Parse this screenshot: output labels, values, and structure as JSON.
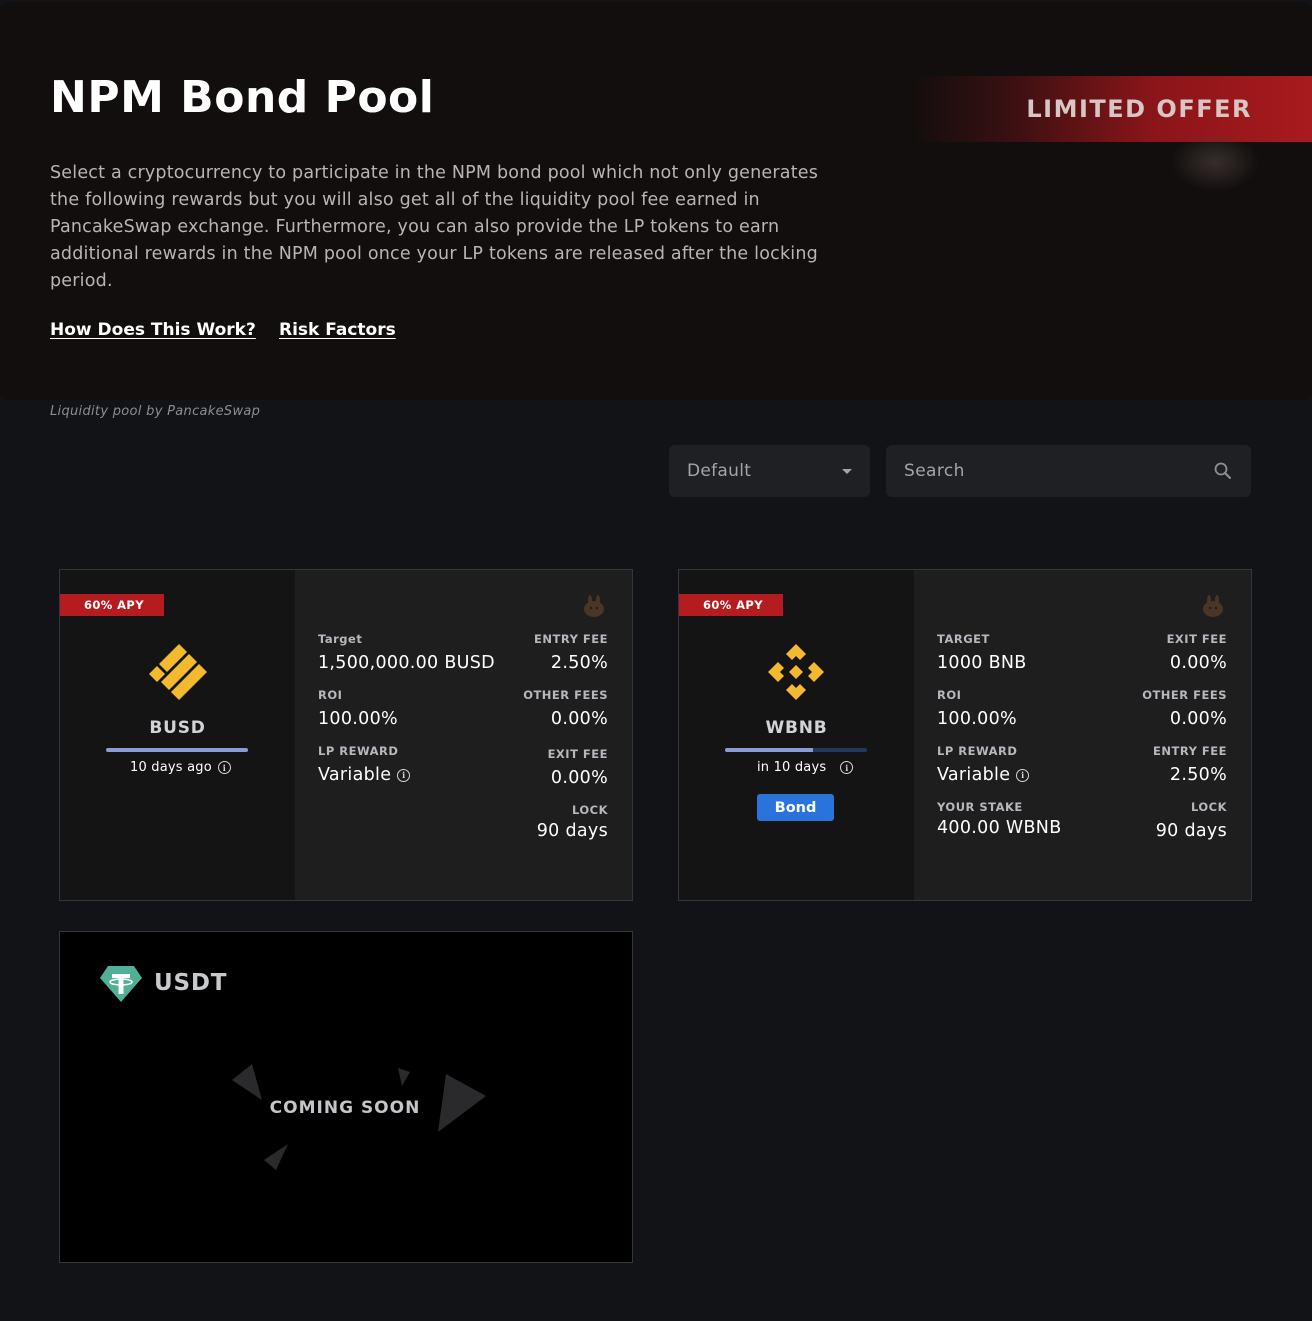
{
  "hero": {
    "title": "NPM Bond Pool",
    "description": "Select a cryptocurrency to participate in the NPM bond pool which not only generates the following rewards but you will also get all of the liquidity pool fee earned in PancakeSwap exchange. Furthermore, you can also provide the LP tokens to earn additional rewards in the NPM pool once your LP tokens are released after the locking period.",
    "link_how": "How Does This Work?",
    "link_risk": "Risk Factors",
    "offer_label": "LIMITED OFFER"
  },
  "caption": "Liquidity pool by PancakeSwap",
  "filters": {
    "sort_value": "Default",
    "search_placeholder": "Search"
  },
  "pools": [
    {
      "apy": "60% APY",
      "coin": "BUSD",
      "progress": 1.0,
      "time": "10 days ago",
      "icon": "pancakeswap-bunny-icon",
      "fields": {
        "l1_label": "Target",
        "l1_value": "1,500,000.00 BUSD",
        "l2_label": "ROI",
        "l2_value": "100.00%",
        "l3_label": "LP REWARD",
        "l3_value": "Variable",
        "r1_label": "ENTRY FEE",
        "r1_value": "2.50%",
        "r2_label": "OTHER FEES",
        "r2_value": "0.00%",
        "r3_label": "EXIT FEE",
        "r3_value": "0.00%",
        "r4_label": "LOCK",
        "r4_value": "90 days"
      }
    },
    {
      "apy": "60% APY",
      "coin": "WBNB",
      "progress": 0.62,
      "time": "in 10 days",
      "button": "Bond",
      "icon": "pancakeswap-bunny-icon",
      "fields": {
        "l1_label": "TARGET",
        "l1_value": "1000 BNB",
        "l2_label": "ROI",
        "l2_value": "100.00%",
        "l3_label": "LP REWARD",
        "l3_value": "Variable",
        "l4_label": "YOUR STAKE",
        "l4_value": "400.00 WBNB",
        "r1_label": "EXIT FEE",
        "r1_value": "0.00%",
        "r2_label": "OTHER FEES",
        "r2_value": "0.00%",
        "r3_label": "ENTRY FEE",
        "r3_value": "2.50%",
        "r4_label": "LOCK",
        "r4_value": "90 days"
      }
    }
  ],
  "coming": {
    "coin": "USDT",
    "text": "COMING SOON"
  },
  "colors": {
    "accent_red": "#b51c20",
    "bond_blue": "#2b73dc",
    "binance_yellow": "#f3ba2f",
    "tether_green": "#50af95"
  }
}
